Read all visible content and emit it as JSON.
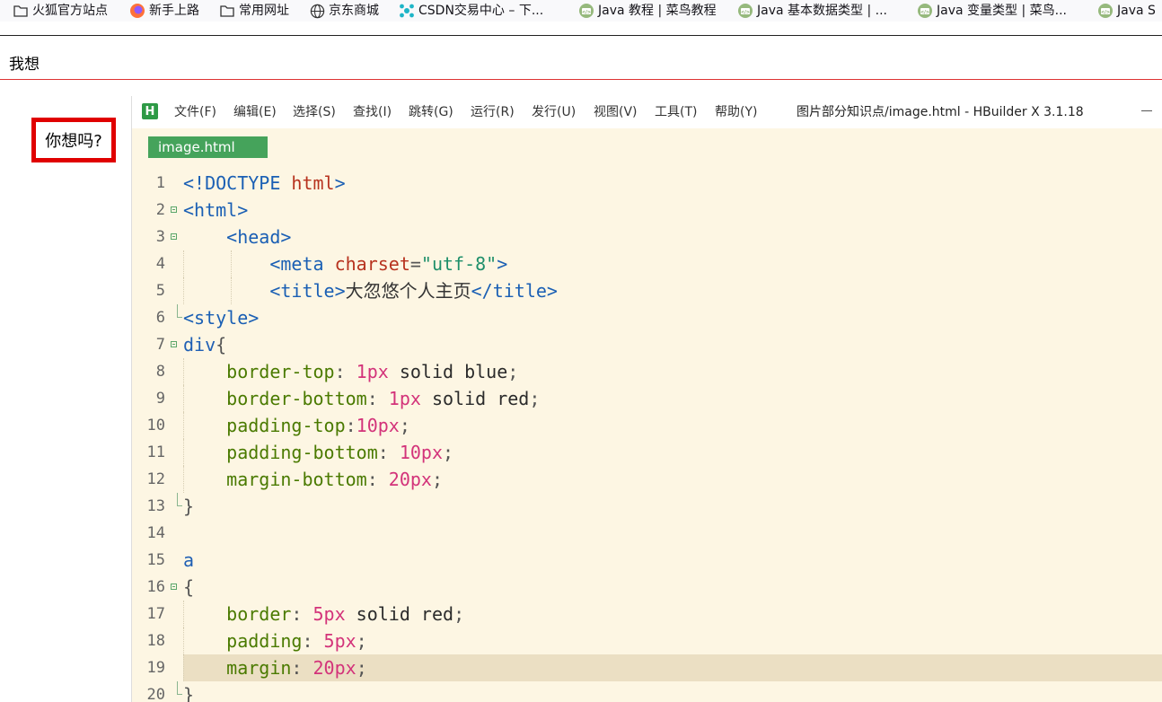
{
  "bookmarks": [
    {
      "icon": "folder-icon",
      "label": "火狐官方站点"
    },
    {
      "icon": "firefox-icon",
      "label": "新手上路"
    },
    {
      "icon": "folder-icon",
      "label": "常用网址"
    },
    {
      "icon": "globe-icon",
      "label": "京东商城"
    },
    {
      "icon": "csdn-icon",
      "label": "CSDN交易中心 – 下..."
    },
    {
      "icon": "runoob-icon",
      "label": "Java 教程 | 菜鸟教程"
    },
    {
      "icon": "runoob-icon",
      "label": "Java 基本数据类型 | ..."
    },
    {
      "icon": "runoob-icon",
      "label": "Java 变量类型 | 菜鸟..."
    },
    {
      "icon": "runoob-icon",
      "label": "Java S"
    }
  ],
  "page": {
    "heading": "我想",
    "box_text": "你想吗?"
  },
  "editor": {
    "logo": "H",
    "menu": [
      "文件(F)",
      "编辑(E)",
      "选择(S)",
      "查找(I)",
      "跳转(G)",
      "运行(R)",
      "发行(U)",
      "视图(V)",
      "工具(T)",
      "帮助(Y)"
    ],
    "window_title": "图片部分知识点/image.html - HBuilder X 3.1.18",
    "tab": "image.html",
    "lines": [
      {
        "n": "1",
        "tokens": [
          [
            "tag",
            "<!DOCTYPE "
          ],
          [
            "name",
            "html"
          ],
          [
            "tag",
            ">"
          ]
        ]
      },
      {
        "n": "2",
        "tokens": [
          [
            "tag",
            "<html>"
          ]
        ]
      },
      {
        "n": "3",
        "tokens": [
          [
            "tag",
            "    <head>"
          ]
        ]
      },
      {
        "n": "4",
        "tokens": [
          [
            "tag",
            "        <meta "
          ],
          [
            "attr",
            "charset"
          ],
          [
            "punct",
            "="
          ],
          [
            "str",
            "\"utf-8\""
          ],
          [
            "tag",
            ">"
          ]
        ]
      },
      {
        "n": "5",
        "tokens": [
          [
            "tag",
            "        <title>"
          ],
          [
            "cn",
            "大忽悠个人主页"
          ],
          [
            "tag",
            "</title>"
          ]
        ]
      },
      {
        "n": "6",
        "tokens": [
          [
            "tag",
            "<style>"
          ]
        ]
      },
      {
        "n": "7",
        "tokens": [
          [
            "sel",
            "div"
          ],
          [
            "punct",
            "{"
          ]
        ]
      },
      {
        "n": "8",
        "tokens": [
          [
            "prop",
            "    border-top"
          ],
          [
            "punct",
            ": "
          ],
          [
            "num",
            "1px"
          ],
          [
            "val",
            " solid blue"
          ],
          [
            "punct",
            ";"
          ]
        ]
      },
      {
        "n": "9",
        "tokens": [
          [
            "prop",
            "    border-bottom"
          ],
          [
            "punct",
            ": "
          ],
          [
            "num",
            "1px"
          ],
          [
            "val",
            " solid red"
          ],
          [
            "punct",
            ";"
          ]
        ]
      },
      {
        "n": "10",
        "tokens": [
          [
            "prop",
            "    padding-top"
          ],
          [
            "punct",
            ":"
          ],
          [
            "num",
            "10px"
          ],
          [
            "punct",
            ";"
          ]
        ]
      },
      {
        "n": "11",
        "tokens": [
          [
            "prop",
            "    padding-bottom"
          ],
          [
            "punct",
            ": "
          ],
          [
            "num",
            "10px"
          ],
          [
            "punct",
            ";"
          ]
        ]
      },
      {
        "n": "12",
        "tokens": [
          [
            "prop",
            "    margin-bottom"
          ],
          [
            "punct",
            ": "
          ],
          [
            "num",
            "20px"
          ],
          [
            "punct",
            ";"
          ]
        ]
      },
      {
        "n": "13",
        "tokens": [
          [
            "punct",
            "}"
          ]
        ]
      },
      {
        "n": "14",
        "tokens": []
      },
      {
        "n": "15",
        "tokens": [
          [
            "sel",
            "a"
          ]
        ]
      },
      {
        "n": "16",
        "tokens": [
          [
            "punct",
            "{"
          ]
        ]
      },
      {
        "n": "17",
        "tokens": [
          [
            "prop",
            "    border"
          ],
          [
            "punct",
            ": "
          ],
          [
            "num",
            "5px"
          ],
          [
            "val",
            " solid red"
          ],
          [
            "punct",
            ";"
          ]
        ]
      },
      {
        "n": "18",
        "tokens": [
          [
            "prop",
            "    padding"
          ],
          [
            "punct",
            ": "
          ],
          [
            "num",
            "5px"
          ],
          [
            "punct",
            ";"
          ]
        ]
      },
      {
        "n": "19",
        "tokens": [
          [
            "prop",
            "    margin"
          ],
          [
            "punct",
            ": "
          ],
          [
            "num",
            "20px"
          ],
          [
            "punct",
            ";"
          ]
        ]
      },
      {
        "n": "20",
        "tokens": [
          [
            "punct",
            "}"
          ]
        ]
      }
    ]
  }
}
